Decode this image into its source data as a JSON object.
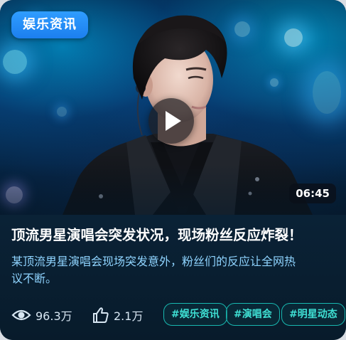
{
  "card": {
    "badge": "娱乐资讯",
    "duration": "06:45",
    "title": "顶流男星演唱会突发状况，现场粉丝反应炸裂！",
    "description": "某顶流男星演唱会现场突发意外，粉丝们的反应让全网热议不断。",
    "stats": {
      "views": "96.3万",
      "likes": "2.1万"
    },
    "tags": [
      "#娱乐资讯",
      "#演唱会",
      "#明星动态"
    ]
  },
  "colors": {
    "badge": "#1c7fef",
    "description": "#8fd4ff",
    "tag": "#3fe0d4",
    "background": "#071a2b"
  },
  "icons": {
    "views": "eye-icon",
    "likes": "thumbs-up-icon",
    "play": "play-icon"
  }
}
